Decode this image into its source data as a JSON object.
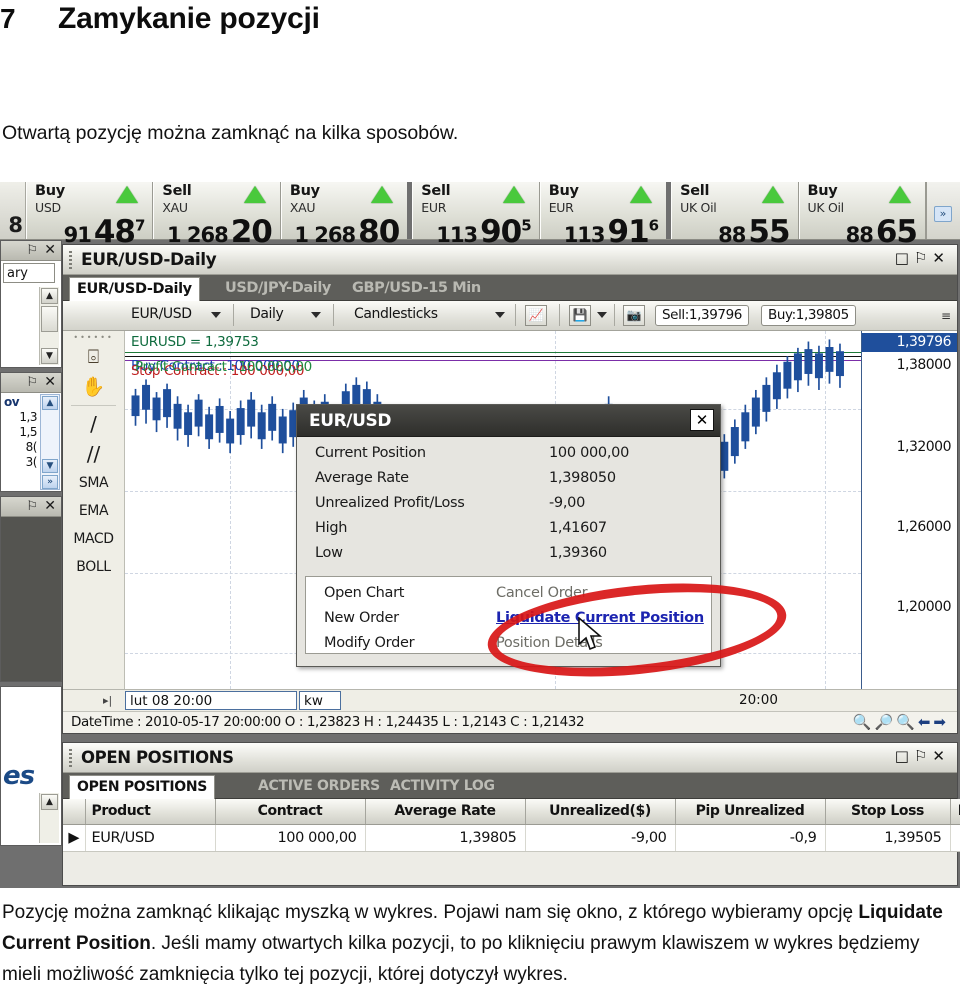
{
  "document": {
    "chapter_number": "7",
    "chapter_title": "Zamykanie pozycji",
    "intro": "Otwartą pozycję można zamknąć na kilka sposobów.",
    "outro_part1": "Pozycję można zamknąć klikając myszką w wykres. Pojawi nam się okno, z którego wybieramy opcję ",
    "outro_bold": "Liquidate Current Position",
    "outro_part2": ". Jeśli mamy otwartych kilka pozycji, to po kliknięciu prawym klawiszem w wykres będziemy mieli możliwość zamknięcia tylko tej pozycji, której dotyczył wykres."
  },
  "ticker": {
    "left_fragment": "8",
    "cells": [
      {
        "side": "Buy",
        "symbol": "USD",
        "price_pre": "91",
        "price_main": "48",
        "price_sup": "7"
      },
      {
        "side": "Sell",
        "symbol": "XAU",
        "price_pre": "1 268",
        "price_main": "20",
        "price_sup": ""
      },
      {
        "side": "Buy",
        "symbol": "XAU",
        "price_pre": "1 268",
        "price_main": "80",
        "price_sup": ""
      },
      {
        "side": "Sell",
        "symbol": "EUR",
        "price_pre": "113",
        "price_main": "90",
        "price_sup": "5"
      },
      {
        "side": "Buy",
        "symbol": "EUR",
        "price_pre": "113",
        "price_main": "91",
        "price_sup": "6"
      },
      {
        "side": "Sell",
        "symbol": "UK Oil",
        "price_pre": "88",
        "price_main": "55",
        "price_sup": ""
      },
      {
        "side": "Buy",
        "symbol": "UK Oil",
        "price_pre": "88",
        "price_main": "65",
        "price_sup": ""
      }
    ],
    "scroll_chevron": "»"
  },
  "left_panels": {
    "panel1": {
      "pin": "⚐",
      "close": "✕",
      "tab_label": "ary"
    },
    "panel2": {
      "pin": "⚐",
      "close": "✕",
      "header": "ov",
      "rows": [
        "1,3",
        "1,5",
        "8(",
        "3("
      ],
      "scroll_up": "▲",
      "scroll_down": "▼",
      "scroll_go": "»"
    },
    "panel3": {
      "pin": "⚐",
      "close": "✕",
      "big_quote": "es"
    }
  },
  "chart_window": {
    "title": "EUR/USD-Daily",
    "window_buttons": {
      "restore": "□",
      "pin": "⚐",
      "close": "✕"
    },
    "tabs": [
      {
        "label": "EUR/USD-Daily",
        "active": true
      },
      {
        "label": "USD/JPY-Daily",
        "active": false
      },
      {
        "label": "GBP/USD-15 Min",
        "active": false
      }
    ],
    "toolbar": {
      "symbol": "EUR/USD",
      "period": "Daily",
      "chart_type": "Candlesticks",
      "indicator_icon": "chart-line-icon",
      "save_icon": "save-icon",
      "camera_icon": "camera-icon",
      "sell_pill": "Sell:1,39796",
      "buy_pill": "Buy:1,39805",
      "overflow": "≡"
    },
    "drawing_tools": {
      "dots": "••••••",
      "cursor_tool": "cursor-tool-icon",
      "hand_tool": "hand-tool-icon",
      "trend_line": "/",
      "parallel_lines": "//",
      "studies": [
        "SMA",
        "EMA",
        "MACD",
        "BOLL"
      ]
    },
    "annotations": {
      "price_label": "EURUSD = 1,39753",
      "overlay_line_1": "Buy Contract : 100 000,00",
      "overlay_line_2": "Stop Contract : 100 000,00",
      "overlay_line_3": "Profit Contract : 100 000,00"
    },
    "y_axis": {
      "current": "1,39796",
      "ticks": [
        "1,38000",
        "1,32000",
        "1,26000",
        "1,20000"
      ]
    },
    "x_axis": {
      "left_label": "lut 08 20:00",
      "mid_label": "kw",
      "right_label": "20:00",
      "scroll_grip": "▸|"
    },
    "status": {
      "text": "DateTime : 2010-05-17 20:00:00 O : 1,23823 H : 1,24435 L : 1,2143 C : 1,21432",
      "tools": [
        "zoom-out-icon",
        "zoom-in-icon",
        "zoom-fit-icon",
        "zoom-reset-icon",
        "nav-back-icon",
        "nav-forward-icon"
      ]
    }
  },
  "popup": {
    "title": "EUR/USD",
    "close_label": "✕",
    "details": [
      {
        "label": "Current Position",
        "value": "100 000,00"
      },
      {
        "label": "Average Rate",
        "value": "1,398050"
      },
      {
        "label": "Unrealized Profit/Loss",
        "value": "-9,00"
      },
      {
        "label": "High",
        "value": "1,41607"
      },
      {
        "label": "Low",
        "value": "1,39360"
      }
    ],
    "menu_left": [
      "Open Chart",
      "New Order",
      "Modify Order"
    ],
    "menu_right": [
      {
        "label": "Cancel Order",
        "state": "disabled"
      },
      {
        "label": "Liquidate Current Position",
        "state": "highlighted"
      },
      {
        "label": "Position Details",
        "state": "disabled"
      }
    ]
  },
  "open_positions": {
    "panel_title": "OPEN POSITIONS",
    "window_buttons": {
      "restore": "□",
      "pin": "⚐",
      "close": "✕"
    },
    "tabs": [
      {
        "label": "OPEN POSITIONS",
        "active": true
      },
      {
        "label": "ACTIVE ORDERS",
        "active": false
      },
      {
        "label": "ACTIVITY LOG",
        "active": false
      }
    ],
    "columns": [
      "",
      "Product",
      "Contract",
      "Average Rate",
      "Unrealized($)",
      "Pip Unrealized",
      "Stop Loss",
      "L"
    ],
    "rows": [
      {
        "marker": "▶",
        "product": "EUR/USD",
        "contract": "100 000,00",
        "average_rate": "1,39805",
        "unrealized": "-9,00",
        "pip_unrealized": "-0,9",
        "stop_loss": "1,39505",
        "last": ""
      }
    ]
  },
  "colors": {
    "highlight_link": "#1c24b0",
    "annotation_ellipse": "#d81616",
    "positive_green": "#1d9b27",
    "negative_red": "#cf2020",
    "selected_blue": "#1f4f9c"
  }
}
